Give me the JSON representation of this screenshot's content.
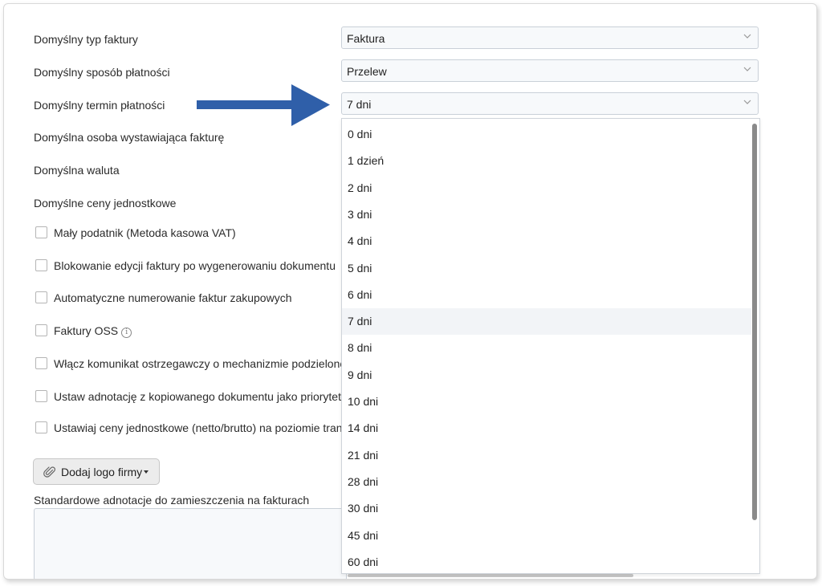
{
  "settings": {
    "invoice_type": {
      "label": "Domyślny typ faktury",
      "value": "Faktura"
    },
    "payment_method": {
      "label": "Domyślny sposób płatności",
      "value": "Przelew"
    },
    "payment_term": {
      "label": "Domyślny termin płatności",
      "value": "7 dni"
    },
    "issuer": {
      "label": "Domyślna osoba wystawiająca fakturę"
    },
    "currency": {
      "label": "Domyślna waluta"
    },
    "unit_prices": {
      "label": "Domyślne ceny jednostkowe"
    }
  },
  "checkboxes": [
    {
      "label": "Mały podatnik (Metoda kasowa VAT)",
      "checked": false
    },
    {
      "label": "Blokowanie edycji faktury po wygenerowaniu dokumentu",
      "checked": false
    },
    {
      "label": "Automatyczne numerowanie faktur zakupowych",
      "checked": false
    },
    {
      "label": "Faktury OSS",
      "checked": false
    },
    {
      "label": "Włącz komunikat ostrzegawczy o mechanizmie podzielonej płatności",
      "checked": false
    },
    {
      "label": "Ustaw adnotację z kopiowanego dokumentu jako priorytetową",
      "checked": false
    },
    {
      "label": "Ustawiaj ceny jednostkowe (netto/brutto) na poziomie transakcji",
      "checked": false
    }
  ],
  "logo_button": {
    "label": "Dodaj logo firmy"
  },
  "notes": {
    "label": "Standardowe adnotacje do zamieszczenia na fakturach"
  },
  "dropdown": {
    "options": [
      "0 dni",
      "1 dzień",
      "2 dni",
      "3 dni",
      "4 dni",
      "5 dni",
      "6 dni",
      "7 dni",
      "8 dni",
      "9 dni",
      "10 dni",
      "14 dni",
      "21 dni",
      "28 dni",
      "30 dni",
      "45 dni",
      "60 dni"
    ],
    "highlighted_index": 7
  },
  "colors": {
    "arrow": "#2f5fa9",
    "highlight": "#f2f4f7"
  },
  "icons": {
    "info": "info-icon",
    "paperclip": "paperclip-icon",
    "chevron": "chevron-down-icon",
    "arrow": "arrow-right-icon"
  }
}
